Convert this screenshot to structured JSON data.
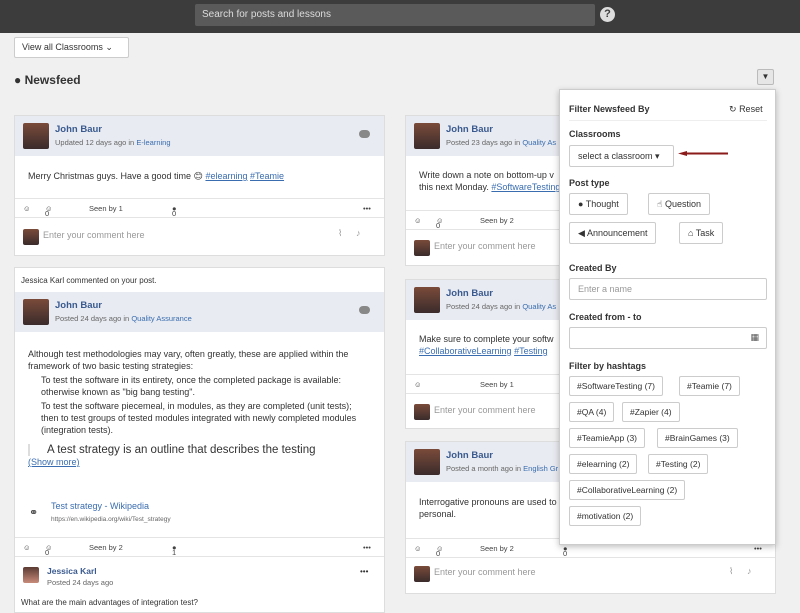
{
  "header": {
    "search_placeholder": "Search for posts and lessons",
    "help_icon": "question-circle-icon"
  },
  "toolbar": {
    "classes_dropdown": "View all Classrooms ⌄",
    "newsfeed_title": "Newsfeed",
    "filter_icon": "filter-icon"
  },
  "posts": [
    {
      "author": "John Baur",
      "meta": "Updated 12 days ago in",
      "classroom": "E-learning",
      "text": "Merry Christmas guys. Have a good time 😊",
      "tags": [
        "#elearning",
        "#Teamie"
      ],
      "reactions": "0",
      "seen": "Seen by 1",
      "comments": "0",
      "comment_placeholder": "Enter your comment here"
    },
    {
      "notice": "Jessica Karl commented on your post.",
      "author": "John Baur",
      "meta": "Posted 24 days ago in",
      "classroom": "Quality Assurance",
      "intro": "Although test methodologies may vary, often greatly, these are applied within the framework of two basic testing strategies:",
      "item1": "To test the software in its entirety, once the completed package is available: otherwise known as \"big bang testing\".",
      "item2": "To test the software piecemeal, in modules, as they are completed (unit tests); then to test groups of tested modules integrated with newly completed modules (integration tests).",
      "quote": "A test strategy is an outline that describes the testing",
      "show_more": "(Show more)",
      "link_title": "Test strategy - Wikipedia",
      "link_url": "https://en.wikipedia.org/wiki/Test_strategy",
      "reactions": "0",
      "seen": "Seen by 2",
      "comments": "1",
      "commenter": "Jessica Karl",
      "commenter_meta": "Posted 24 days ago",
      "comment_text": "What are the main advantages of integration test?"
    }
  ],
  "posts_right": [
    {
      "author": "John Baur",
      "meta": "Posted 23 days ago in",
      "classroom": "Quality As",
      "text": "Write down a note on bottom-up v",
      "text2": "this next Monday.",
      "tag": "#SoftwareTesting",
      "seen": "Seen by 2",
      "reactions": "0",
      "comment_placeholder": "Enter your comment here"
    },
    {
      "author": "John Baur",
      "meta": "Posted 24 days ago in",
      "classroom": "Quality As",
      "text": "Make sure to complete your softw",
      "tags": [
        "#CollaborativeLearning",
        "#Testing"
      ],
      "seen": "Seen by 1",
      "comment_placeholder": "Enter your comment here"
    },
    {
      "author": "John Baur",
      "meta": "Posted a month ago in",
      "classroom": "English Gr",
      "text": "Interrogative pronouns are used to",
      "text2": "personal.",
      "reactions": "0",
      "seen": "Seen by 2",
      "comments": "0",
      "comment_placeholder": "Enter your comment here"
    }
  ],
  "filter": {
    "title": "Filter Newsfeed By",
    "reset": "Reset",
    "classrooms_label": "Classrooms",
    "classroom_select": "select a classroom ▾",
    "post_type_label": "Post type",
    "post_types": [
      "Thought",
      "Question",
      "Announcement",
      "Task"
    ],
    "created_by_label": "Created By",
    "created_by_placeholder": "Enter a name",
    "created_range_label": "Created from - to",
    "hashtags_label": "Filter by hashtags",
    "hashtags": [
      "#SoftwareTesting (7)",
      "#Teamie (7)",
      "#QA (4)",
      "#Zapier (4)",
      "#TeamieApp (3)",
      "#BrainGames (3)",
      "#elearning (2)",
      "#Testing (2)",
      "#CollaborativeLearning (2)",
      "#motivation (2)"
    ]
  },
  "colors": {
    "topbar": "#3c3c3c",
    "link": "#3a6db0",
    "arrow": "#8b1a1a"
  }
}
